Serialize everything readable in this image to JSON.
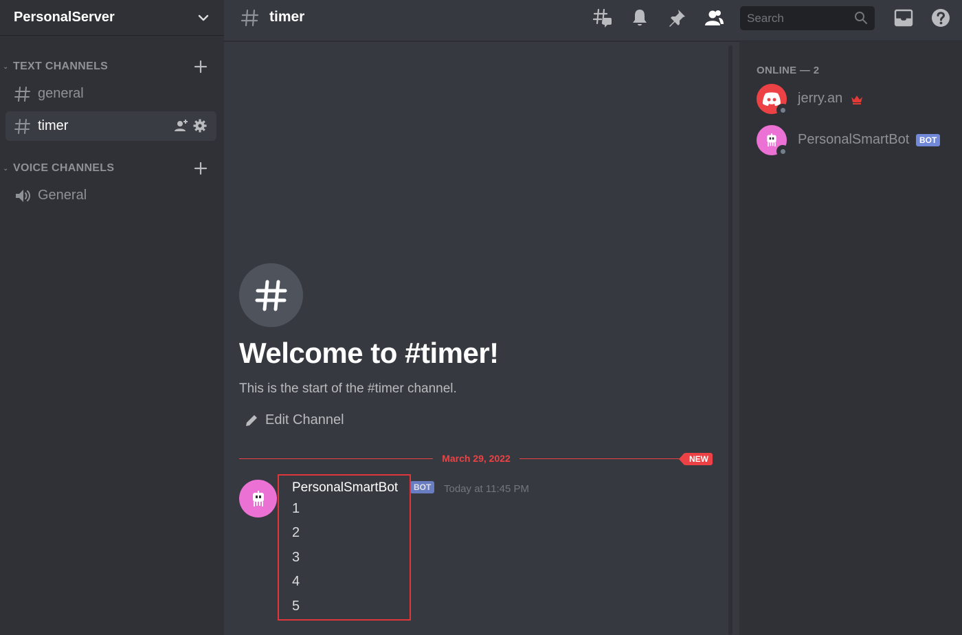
{
  "server": {
    "name": "PersonalServer"
  },
  "sidebar": {
    "categories": [
      {
        "label": "TEXT CHANNELS"
      },
      {
        "label": "VOICE CHANNELS"
      }
    ],
    "text_channels": [
      {
        "label": "general"
      },
      {
        "label": "timer",
        "active": true
      }
    ],
    "voice_channels": [
      {
        "label": "General"
      }
    ]
  },
  "header": {
    "channel_name": "timer",
    "search_placeholder": "Search"
  },
  "welcome": {
    "title": "Welcome to #timer!",
    "subtitle": "This is the start of the #timer channel.",
    "edit_label": "Edit Channel"
  },
  "divider": {
    "date": "March 29, 2022",
    "badge": "NEW"
  },
  "message": {
    "author": "PersonalSmartBot",
    "bot_tag": "BOT",
    "timestamp": "Today at 11:45 PM",
    "lines": [
      "1",
      "2",
      "3",
      "4",
      "5"
    ]
  },
  "members": {
    "heading": "ONLINE — 2",
    "list": [
      {
        "name": "jerry.an",
        "avatar_color": "#ed4245",
        "owner": true
      },
      {
        "name": "PersonalSmartBot",
        "avatar_color": "#eb72d4",
        "bot_tag": "BOT"
      }
    ]
  },
  "colors": {
    "accent_red": "#ed4245",
    "bot_pink": "#eb72d4",
    "blurple": "#5865f2"
  }
}
